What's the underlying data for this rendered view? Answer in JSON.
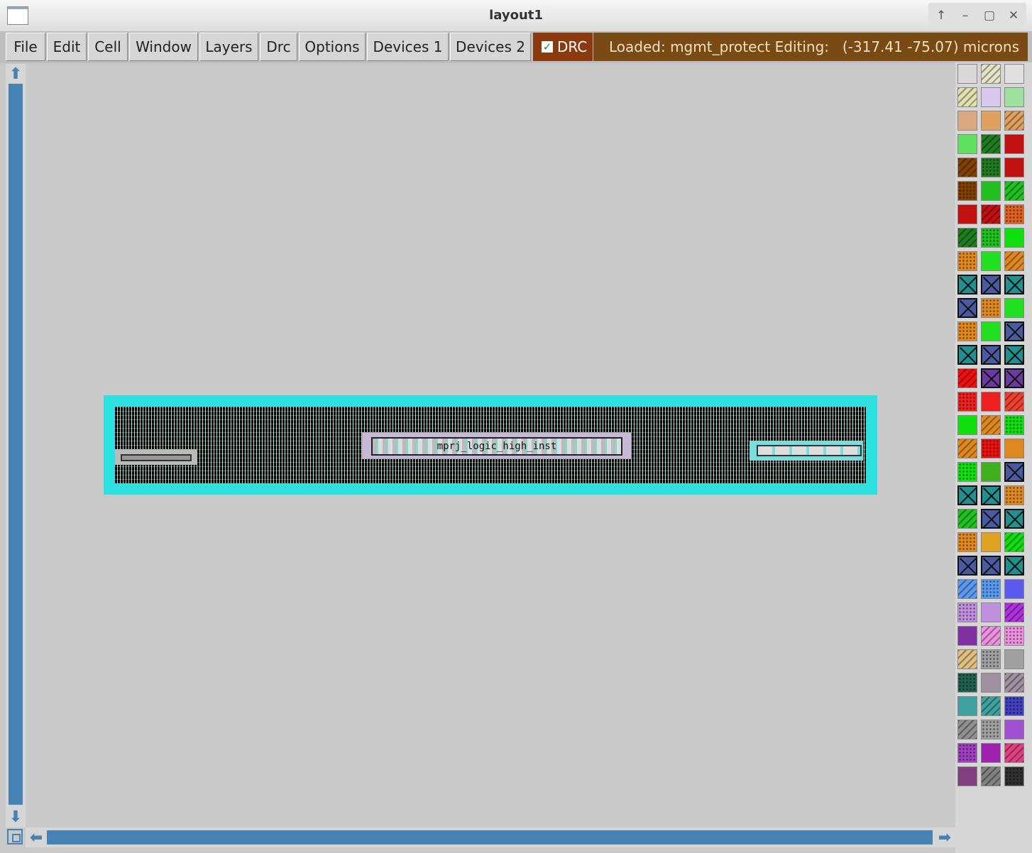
{
  "window": {
    "title": "layout1",
    "controls": [
      "↑",
      "–",
      "▢",
      "✕"
    ]
  },
  "menu": {
    "items": [
      {
        "label": "File"
      },
      {
        "label": "Edit"
      },
      {
        "label": "Cell"
      },
      {
        "label": "Window"
      },
      {
        "label": "Layers"
      },
      {
        "label": "Drc"
      },
      {
        "label": "Options"
      },
      {
        "label": "Devices 1"
      },
      {
        "label": "Devices 2"
      }
    ],
    "drc_label": "DRC",
    "drc_checked": true
  },
  "status": {
    "loaded": "Loaded: mgmt_protect Editing: m",
    "coords": "(-317.41 -75.07) microns"
  },
  "layout": {
    "cell_label": "mprj_logic_high_inst"
  },
  "colors": {
    "accent": "#4682b4",
    "drc_bg": "#8b3a0f",
    "status_bg": "#7a4a15",
    "cell_boundary": "#2fe0e0"
  },
  "palette": [
    [
      "#d8d8d8",
      "#e4e4c8",
      "#e0e0e0"
    ],
    [
      "#e0e0b0",
      "#d8c8ec",
      "#a0e0a0"
    ],
    [
      "#d8a880",
      "#e0a060",
      "#e0a060"
    ],
    [
      "#60e060",
      "#207a20",
      "#c01010"
    ],
    [
      "#804000",
      "#207a20",
      "#c01010"
    ],
    [
      "#804000",
      "#20c020",
      "#20c020"
    ],
    [
      "#c01010",
      "#c01010",
      "#e06020"
    ],
    [
      "#207a20",
      "#20c020",
      "#10e010"
    ],
    [
      "#e08820",
      "#20e020",
      "#e08820"
    ],
    [
      "#209090",
      "#4a5aa0",
      "#209090"
    ],
    [
      "#4a5aa0",
      "#e08820",
      "#20e020"
    ],
    [
      "#e08820",
      "#20e020",
      "#4a5aa0"
    ],
    [
      "#209090",
      "#4a5aa0",
      "#209090"
    ],
    [
      "#ee1010",
      "#6a3aa0",
      "#6a3aa0"
    ],
    [
      "#ee2020",
      "#ee2020",
      "#ee4030"
    ],
    [
      "#10e010",
      "#e08820",
      "#10e010"
    ],
    [
      "#e08820",
      "#ee1010",
      "#e08820"
    ],
    [
      "#10e010",
      "#40b020",
      "#4a5aa0"
    ],
    [
      "#209090",
      "#209090",
      "#e08820"
    ],
    [
      "#20c020",
      "#4a5aa0",
      "#209090"
    ],
    [
      "#e08820",
      "#e0a020",
      "#10e010"
    ],
    [
      "#4a5aa0",
      "#4a5aa0",
      "#209090"
    ],
    [
      "#5a9aee",
      "#5a9aee",
      "#5a5aee"
    ],
    [
      "#c090e0",
      "#c090e0",
      "#b030e0"
    ],
    [
      "#8030a0",
      "#ee90e0",
      "#ee90e0"
    ],
    [
      "#e0c080",
      "#a0a0a0",
      "#a0a0a0"
    ],
    [
      "#206050",
      "#a090a0",
      "#a090a0"
    ],
    [
      "#40a0a0",
      "#40a0a0",
      "#4040c0"
    ],
    [
      "#909090",
      "#a0a0a0",
      "#a050d0"
    ],
    [
      "#a040c0",
      "#a020b0",
      "#e04080"
    ],
    [
      "#804080",
      "#808080",
      "#303030"
    ]
  ]
}
